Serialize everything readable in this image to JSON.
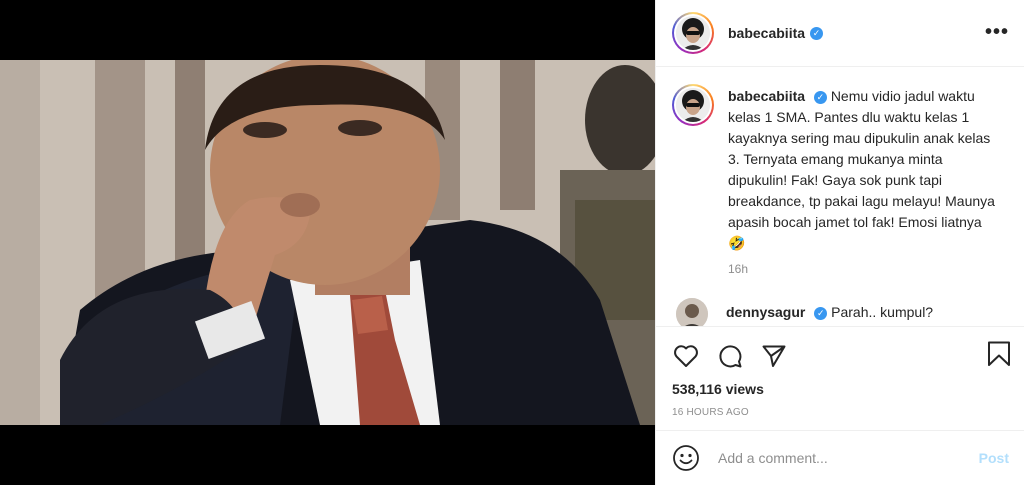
{
  "post": {
    "username": "babecabiita",
    "verified_glyph": "✓",
    "more_glyph": "•••",
    "caption": "Nemu vidio jadul waktu kelas 1 SMA. Pantes dlu waktu kelas 1 kayaknya sering mau dipukulin anak kelas 3. Ternyata emang mukanya minta dipukulin! Fak! Gaya sok punk tapi breakdance, tp pakai lagu melayu! Maunya apasih bocah jamet tol fak! Emosi liatnya 🤣",
    "caption_time": "16h",
    "views": "538,116 views",
    "timestamp": "16 HOURS AGO"
  },
  "comments": [
    {
      "username": "dennysagur",
      "text": "Parah.. kumpul?"
    }
  ],
  "composer": {
    "placeholder": "Add a comment...",
    "post_label": "Post"
  },
  "icons": {
    "like": "heart-icon",
    "comment": "comment-icon",
    "share": "paper-plane-icon",
    "save": "bookmark-icon",
    "emoji": "smiley-icon",
    "mute": "speaker-icon",
    "more": "more-icon"
  },
  "colors": {
    "verified": "#3897f0",
    "post_disabled": "#b2dffc",
    "muted_text": "#8e8e8e"
  }
}
